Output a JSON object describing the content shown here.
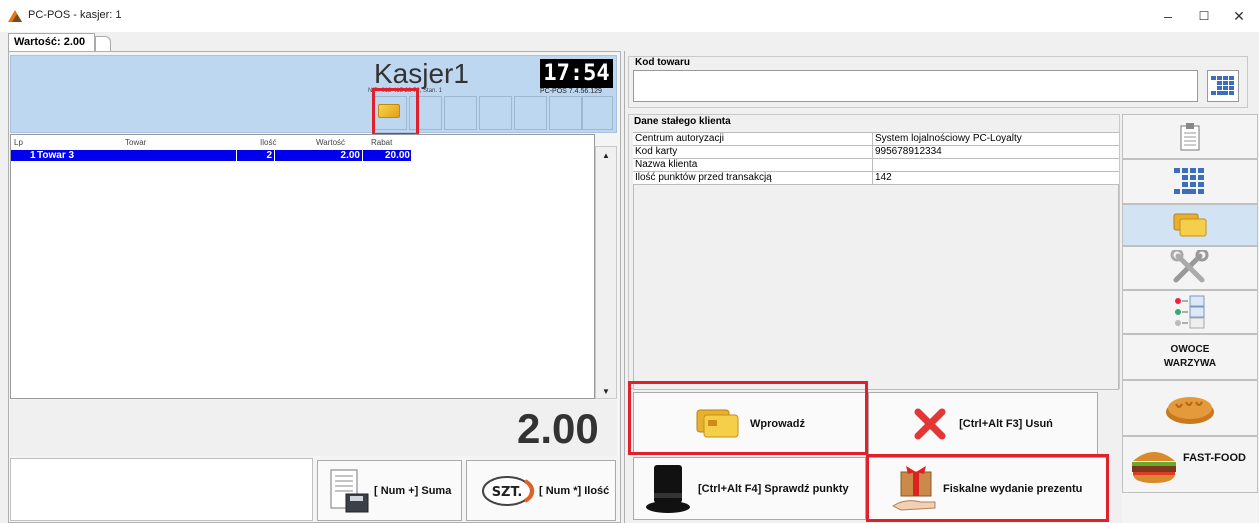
{
  "window": {
    "title": "PC-POS - kasjer: 1",
    "minimize": "–",
    "maximize": "☐",
    "close": "✕"
  },
  "tab": {
    "label": "Wartość: 2.00"
  },
  "header": {
    "cashier": "Kasjer1",
    "subtitle": "NIP: 012 415 23 72, Stan. 1",
    "time": "17:54",
    "version": "PC-POS 7.4.56.129"
  },
  "table": {
    "columns": [
      "Lp",
      "Towar",
      "Ilość",
      "Wartość",
      "Rabat"
    ],
    "rows": [
      {
        "lp": "1",
        "towar": "Towar 3",
        "ilosc": "2",
        "wartosc": "2.00",
        "rabat": "20.00"
      }
    ]
  },
  "total": "2.00",
  "buttons": {
    "suma": "[ Num +] Suma",
    "ilosc": "[ Num *] Ilość",
    "szt": "SZT.",
    "wprowadz": "Wprowadź",
    "usun": "[Ctrl+Alt F3] Usuń",
    "sprawdz": "[Ctrl+Alt F4] Sprawdź punkty",
    "fiskalne": "Fiskalne wydanie prezentu"
  },
  "product_code": {
    "label": "Kod towaru",
    "value": ""
  },
  "client": {
    "group_label": "Dane stałego klienta",
    "rows": [
      {
        "key": "Centrum autoryzacji",
        "value": "System lojalnościowy PC-Loyalty"
      },
      {
        "key": "Kod karty",
        "value": "995678912334"
      },
      {
        "key": "Nazwa klienta",
        "value": ""
      },
      {
        "key": "Ilość punktów przed transakcją",
        "value": "142"
      }
    ]
  },
  "side_tabs": {
    "owoce": "OWOCE\nWARZYWA",
    "fastfood": "FAST-FOOD"
  }
}
